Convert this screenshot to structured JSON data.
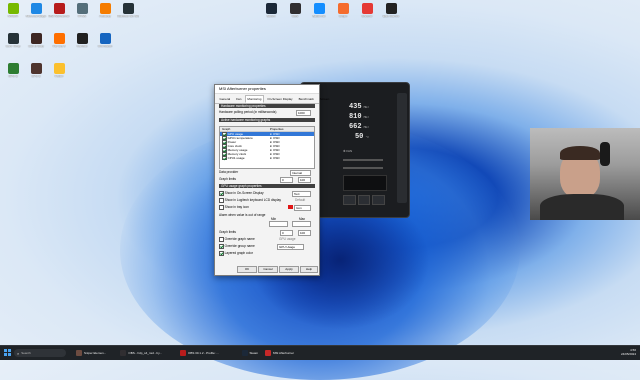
{
  "desktop_icons_top_left": [
    {
      "label": "NVIDIA",
      "color": "#76b900"
    },
    {
      "label": "Microsoft Edge",
      "color": "#1e88e5"
    },
    {
      "label": "MSI Afterburner",
      "color": "#b71c1c"
    },
    {
      "label": "RTSS",
      "color": "#546e7a"
    },
    {
      "label": "Audacity",
      "color": "#f57c00"
    },
    {
      "label": "Rainbow Six Siege",
      "color": "#263238"
    }
  ],
  "desktop_icons_row2": [
    {
      "label": "Core Temp",
      "color": "#263238"
    },
    {
      "label": "Call of Duty",
      "color": "#3e2723"
    },
    {
      "label": "Far Cry 5",
      "color": "#ff6f00"
    },
    {
      "label": "Kombat",
      "color": "#212121"
    },
    {
      "label": "Overwatch",
      "color": "#1565c0"
    }
  ],
  "desktop_icons_row3": [
    {
      "label": "GPU-Z",
      "color": "#2e7d32"
    },
    {
      "label": "CPU-Z",
      "color": "#4e342e"
    },
    {
      "label": "Folder",
      "color": "#fbc02d"
    }
  ],
  "desktop_icons_top_right": [
    {
      "label": "Steam",
      "color": "#1b2838"
    },
    {
      "label": "OBS",
      "color": "#302e31"
    },
    {
      "label": "Battle.net",
      "color": "#148eff"
    },
    {
      "label": "Origin",
      "color": "#f56c2d"
    },
    {
      "label": "Chrome",
      "color": "#e53935"
    },
    {
      "label": "Epic Games",
      "color": "#222222"
    }
  ],
  "skin": {
    "readouts": [
      {
        "value": "435",
        "unit": "MHz"
      },
      {
        "value": "810",
        "unit": "MHz"
      },
      {
        "value": "662",
        "unit": "MHz"
      },
      {
        "value": "50",
        "unit": "°C"
      }
    ],
    "fan_label": "FAN"
  },
  "dialog": {
    "title": "MSI Afterburner properties",
    "tabs": [
      "General",
      "Fan",
      "Monitoring",
      "On-Screen Display",
      "Benchmark",
      "Screen"
    ],
    "active_tab": "Monitoring",
    "section1": "Hardware monitoring properties",
    "polling_label": "Hardware polling period (in milliseconds)",
    "polling_value": "1000",
    "section2": "Active hardware monitoring graphs",
    "table_headers": [
      "Graph",
      "Properties"
    ],
    "graphs": [
      {
        "name": "GPU usage",
        "props": "in OSD",
        "on": true,
        "selected": true
      },
      {
        "name": "GPU1 temperature",
        "props": "in OSD",
        "on": true,
        "selected": false
      },
      {
        "name": "Power",
        "props": "in OSD",
        "on": true,
        "selected": false
      },
      {
        "name": "Core clock",
        "props": "in OSD",
        "on": true,
        "selected": false
      },
      {
        "name": "Memory usage",
        "props": "in OSD",
        "on": true,
        "selected": false
      },
      {
        "name": "Memory clock",
        "props": "in OSD",
        "on": true,
        "selected": false
      },
      {
        "name": "CPU1 usage",
        "props": "in OSD",
        "on": true,
        "selected": false
      }
    ],
    "data_provider_label": "Data provider",
    "data_provider_value": "Internal",
    "graph_limits_label": "Graph limits",
    "graph_limits_min": "0",
    "graph_limits_max": "100",
    "section3": "GPU usage graph properties",
    "osd_label": "Show in On-Screen Display",
    "osd_mode": "Text",
    "tray_label": "Show in Logitech keyboard LCD display",
    "tray_mode": "Default",
    "tray2_label": "Show in tray icon",
    "tray2_mode": "Icon",
    "alarm_label": "Alarm when value is out of range",
    "alarm_min": "Min",
    "alarm_max": "Max",
    "graph_limits2_label": "Graph limits",
    "graph_limits2_min": "0",
    "graph_limits2_max": "100",
    "override_name_label": "Override graph name",
    "override_name_value": "GPU usage",
    "override_group_label": "Override group name",
    "override_group_value": "GPU Usage",
    "layered_label": "Layered graph color",
    "buttons": [
      "OK",
      "Cancel",
      "Apply",
      "Help"
    ]
  },
  "taskbar": {
    "search_placeholder": "Search",
    "apps": [
      {
        "label": "Sniper Elemen...",
        "color": "#6d4c41"
      },
      {
        "label": "OBS - hdp_s4_nsd - by...",
        "color": "#302e31"
      },
      {
        "label": "OBS 30.1.2 - Profile: ...",
        "color": "#b71c1c"
      },
      {
        "label": "Steam",
        "color": "#1b2838"
      },
      {
        "label": "MSI Afterburner",
        "color": "#c62828"
      }
    ],
    "time": "4:56",
    "date": "24/05/2024"
  },
  "colors": {
    "accent": "#3277d7",
    "taskbar": "#1f2327"
  }
}
